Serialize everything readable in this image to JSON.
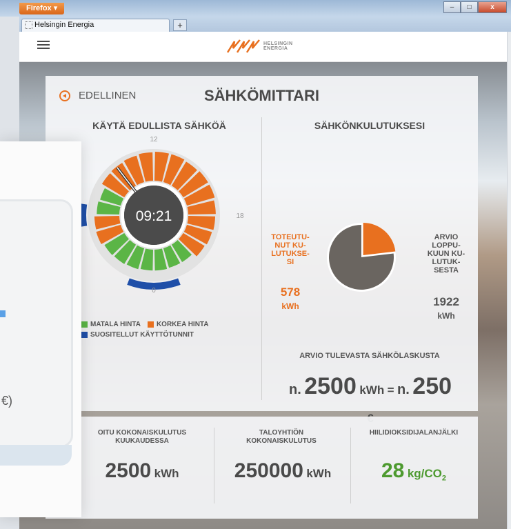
{
  "browser": {
    "app_button": "Firefox",
    "tab_title": "Helsingin Energia",
    "new_tab": "+",
    "win_min": "–",
    "win_max": "□",
    "win_close": "x"
  },
  "site": {
    "logo_line1": "HELSINGIN",
    "logo_line2": "ENERGIA",
    "brand_color": "#e8701f"
  },
  "meter": {
    "back_label": "EDELLINEN",
    "title": "SÄHKÖMITTARI",
    "left_heading": "KÄYTÄ EDULLISTA SÄHKÖÄ",
    "right_heading": "SÄHKÖNKULUTUKSESI",
    "clock_time": "09:21",
    "clock_labels": {
      "top": "12",
      "right": "18",
      "bottom": "0"
    },
    "legend": {
      "low_price": "MATALA HINTA",
      "high_price": "KORKEA HINTA",
      "recommended": "SUOSITELLUT KÄYTTÖTUNNIT"
    },
    "colors": {
      "low": "#5bb546",
      "high": "#e8701f",
      "recommended": "#1f4fa8",
      "dark": "#4b4b4b"
    }
  },
  "consumption": {
    "actual_label": "TOTEUTU-\nNUT KU-\nLUTUKSE-\nSI",
    "actual_value": "578",
    "actual_unit": "kWh",
    "estimate_label": "ARVIO\nLOPPU-\nKUUN KU-\nLUTUK-\nSESTA",
    "estimate_value": "1922",
    "estimate_unit": "kWh",
    "pie": {
      "actual": 578,
      "estimate": 1922
    }
  },
  "bill": {
    "heading": "ARVIO TULEVASTA SÄHKÖLASKUSTA",
    "prefix1": "n.",
    "kwh": "2500",
    "unit1": "kWh",
    "equals": "=",
    "prefix2": "n.",
    "euros": "250",
    "currency": "€"
  },
  "stats": {
    "monthly_head": "OITU KOKONAISKULUTUS\nKUUKAUDESSA",
    "monthly_value": "2500",
    "monthly_unit": "kWh",
    "building_head": "TALOYHTIÖN\nKOKONAISKULUTUS",
    "building_value": "250000",
    "building_unit": "kWh",
    "carbon_head": "HIILIDIOKSIDIJALANJÄLKI",
    "carbon_value": "28",
    "carbon_unit": "kg/CO",
    "carbon_sub": "2"
  },
  "device_photo": {
    "text": "€)"
  }
}
